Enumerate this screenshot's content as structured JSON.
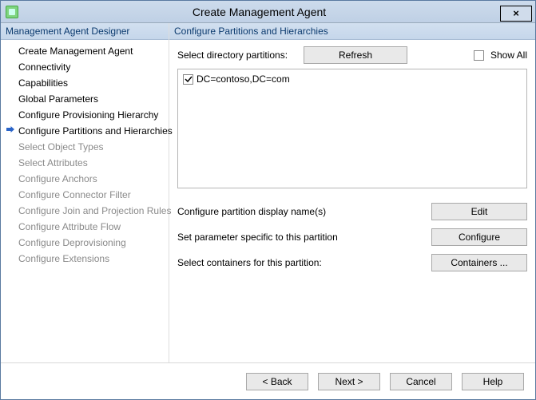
{
  "window": {
    "title": "Create Management Agent",
    "close": "×"
  },
  "sidebar": {
    "header": "Management Agent Designer",
    "items": [
      {
        "label": "Create Management Agent",
        "state": "done"
      },
      {
        "label": "Connectivity",
        "state": "done"
      },
      {
        "label": "Capabilities",
        "state": "done"
      },
      {
        "label": "Global Parameters",
        "state": "done"
      },
      {
        "label": "Configure Provisioning Hierarchy",
        "state": "done"
      },
      {
        "label": "Configure Partitions and Hierarchies",
        "state": "current"
      },
      {
        "label": "Select Object Types",
        "state": "pending"
      },
      {
        "label": "Select Attributes",
        "state": "pending"
      },
      {
        "label": "Configure Anchors",
        "state": "pending"
      },
      {
        "label": "Configure Connector Filter",
        "state": "pending"
      },
      {
        "label": "Configure Join and Projection Rules",
        "state": "pending"
      },
      {
        "label": "Configure Attribute Flow",
        "state": "pending"
      },
      {
        "label": "Configure Deprovisioning",
        "state": "pending"
      },
      {
        "label": "Configure Extensions",
        "state": "pending"
      }
    ]
  },
  "panel": {
    "header": "Configure Partitions and Hierarchies",
    "select_label": "Select directory partitions:",
    "refresh_label": "Refresh",
    "showall_label": "Show All",
    "showall_checked": false,
    "partitions": [
      {
        "label": "DC=contoso,DC=com",
        "checked": true
      }
    ],
    "opts": [
      {
        "label": "Configure partition display name(s)",
        "button": "Edit"
      },
      {
        "label": "Set parameter specific to this partition",
        "button": "Configure"
      },
      {
        "label": "Select containers for this partition:",
        "button": "Containers ..."
      }
    ]
  },
  "footer": {
    "back": "<  Back",
    "next": "Next  >",
    "cancel": "Cancel",
    "help": "Help"
  }
}
